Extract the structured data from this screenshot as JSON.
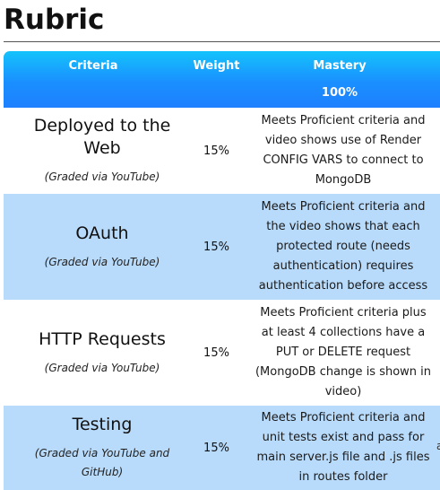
{
  "page": {
    "title": "Rubric"
  },
  "table": {
    "headers": {
      "criteria": "Criteria",
      "weight": "Weight",
      "mastery": "Mastery",
      "mastery_pct": "100%"
    },
    "rows": [
      {
        "criteria": "Deployed to the Web",
        "note": "(Graded via YouTube)",
        "weight": "15%",
        "mastery": "Meets Proficient criteria and video shows use of Render CONFIG VARS to connect to MongoDB"
      },
      {
        "criteria": "OAuth",
        "note": "(Graded via YouTube)",
        "weight": "15%",
        "mastery": "Meets Proficient criteria and the video shows that each protected route (needs authentication) requires authentication before access"
      },
      {
        "criteria": "HTTP Requests",
        "note": "(Graded via YouTube)",
        "weight": "15%",
        "mastery": "Meets Proficient criteria plus at least 4 collections have a PUT or DELETE request (MongoDB change is shown in video)"
      },
      {
        "criteria": "Testing",
        "note": "(Graded via YouTube and GitHub)",
        "weight": "15%",
        "mastery": "Meets Proficient criteria and unit tests exist and pass for main server.js file and .js files in routes folder",
        "edge_fragment": "a"
      }
    ]
  }
}
